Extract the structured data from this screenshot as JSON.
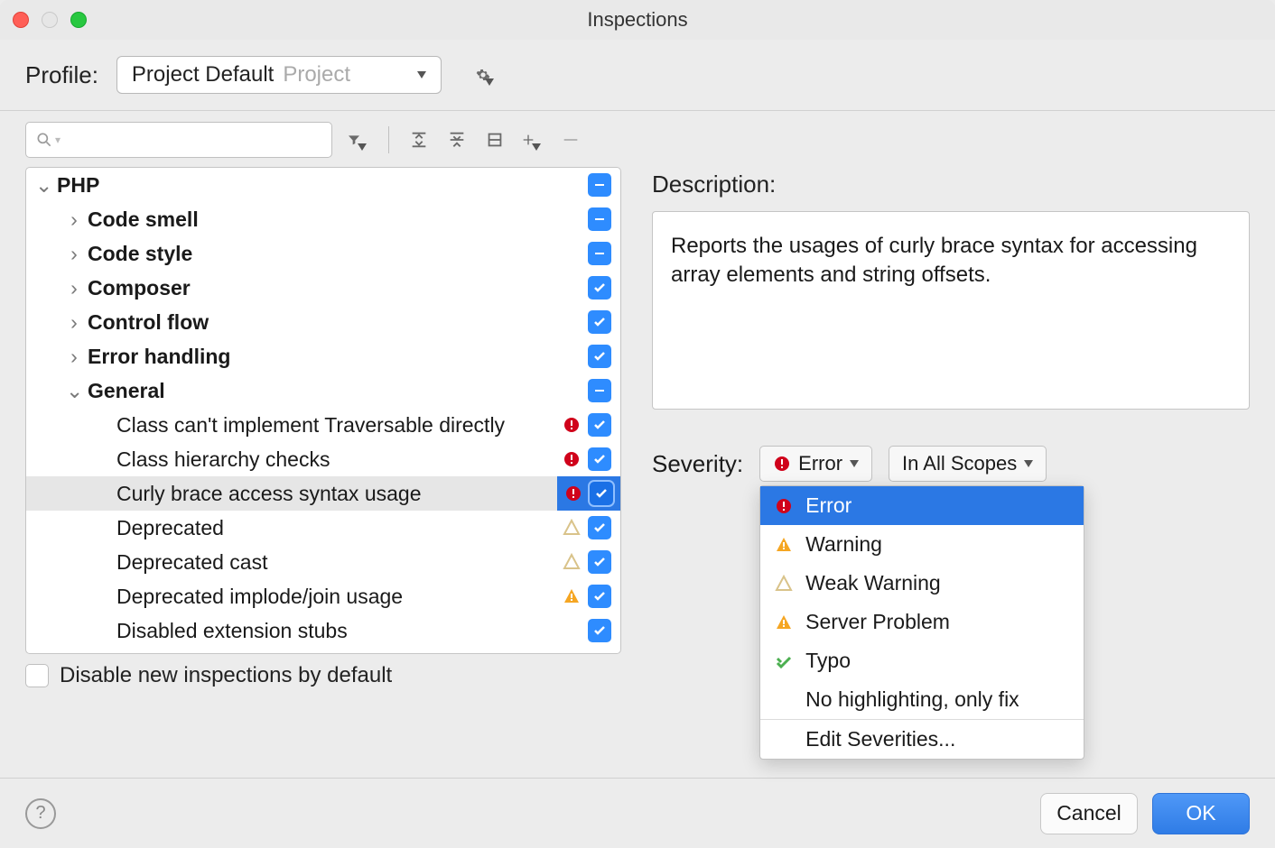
{
  "window": {
    "title": "Inspections"
  },
  "profile": {
    "label": "Profile:",
    "selected_name": "Project Default",
    "selected_scope": "Project"
  },
  "toolbar": {
    "search_placeholder": ""
  },
  "tree": {
    "root": "PHP",
    "groups": [
      {
        "label": "Code smell",
        "state": "partial"
      },
      {
        "label": "Code style",
        "state": "partial"
      },
      {
        "label": "Composer",
        "state": "checked"
      },
      {
        "label": "Control flow",
        "state": "checked"
      },
      {
        "label": "Error handling",
        "state": "checked"
      },
      {
        "label": "General",
        "state": "partial",
        "expanded": true
      }
    ],
    "items": [
      {
        "label": "Class can't implement Traversable directly",
        "severity": "error",
        "checked": true
      },
      {
        "label": "Class hierarchy checks",
        "severity": "error",
        "checked": true
      },
      {
        "label": "Curly brace access syntax usage",
        "severity": "error",
        "checked": true,
        "selected": true
      },
      {
        "label": "Deprecated",
        "severity": "weak",
        "checked": true
      },
      {
        "label": "Deprecated cast",
        "severity": "weak",
        "checked": true
      },
      {
        "label": "Deprecated implode/join usage",
        "severity": "warning",
        "checked": true
      },
      {
        "label": "Disabled extension stubs",
        "severity": "none",
        "checked": true
      }
    ],
    "disable_new_label": "Disable new inspections by default"
  },
  "description": {
    "label": "Description:",
    "text": "Reports the usages of curly brace syntax for accessing array elements and string offsets."
  },
  "severity": {
    "label": "Severity:",
    "combo_value": "Error",
    "scope_value": "In All Scopes",
    "options": [
      {
        "label": "Error",
        "icon": "error"
      },
      {
        "label": "Warning",
        "icon": "warning"
      },
      {
        "label": "Weak Warning",
        "icon": "weak"
      },
      {
        "label": "Server Problem",
        "icon": "server"
      },
      {
        "label": "Typo",
        "icon": "typo"
      },
      {
        "label": "No highlighting, only fix",
        "icon": "none"
      }
    ],
    "edit_label": "Edit Severities..."
  },
  "buttons": {
    "cancel": "Cancel",
    "ok": "OK"
  }
}
